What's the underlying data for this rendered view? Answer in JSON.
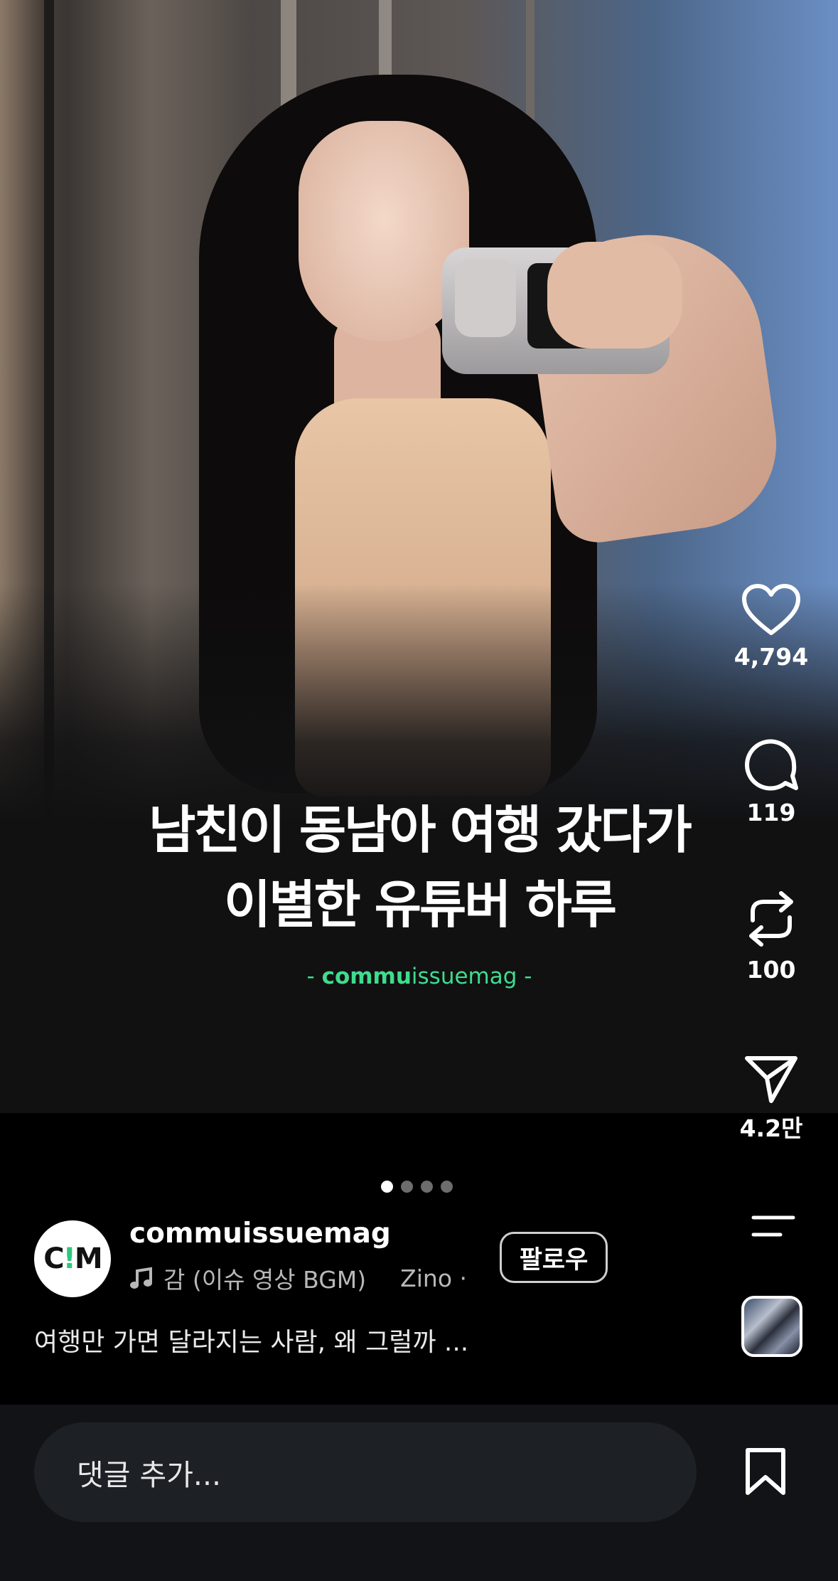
{
  "post": {
    "headline_line1": "남친이 동남아 여행 갔다가",
    "headline_line2": "이별한 유튜버 하루",
    "watermark_prefix": "- ",
    "watermark_bold": "commu",
    "watermark_rest": "issuemag",
    "watermark_suffix": " -"
  },
  "actions": {
    "like_count": "4,794",
    "comment_count": "119",
    "repost_count": "100",
    "share_count": "4.2만"
  },
  "carousel": {
    "total": 4,
    "active": 1
  },
  "author": {
    "avatar_text_left": "C",
    "avatar_text_mid": "!",
    "avatar_text_right": "M",
    "username": "commuissuemag",
    "follow_label": "팔로우",
    "music_title": "감 (이슈 영상 BGM)",
    "music_artist": "Zino ·"
  },
  "caption": "여행만 가면 달라지는 사람, 왜 그럴까 ...",
  "comment_bar": {
    "placeholder": "댓글 추가..."
  },
  "icons": [
    "heart-icon",
    "comment-icon",
    "repost-icon",
    "share-icon",
    "menu-icon",
    "music-note-icon",
    "bookmark-icon"
  ],
  "colors": {
    "accent": "#3fdc8d",
    "background": "#000000",
    "bar": "#111317"
  }
}
